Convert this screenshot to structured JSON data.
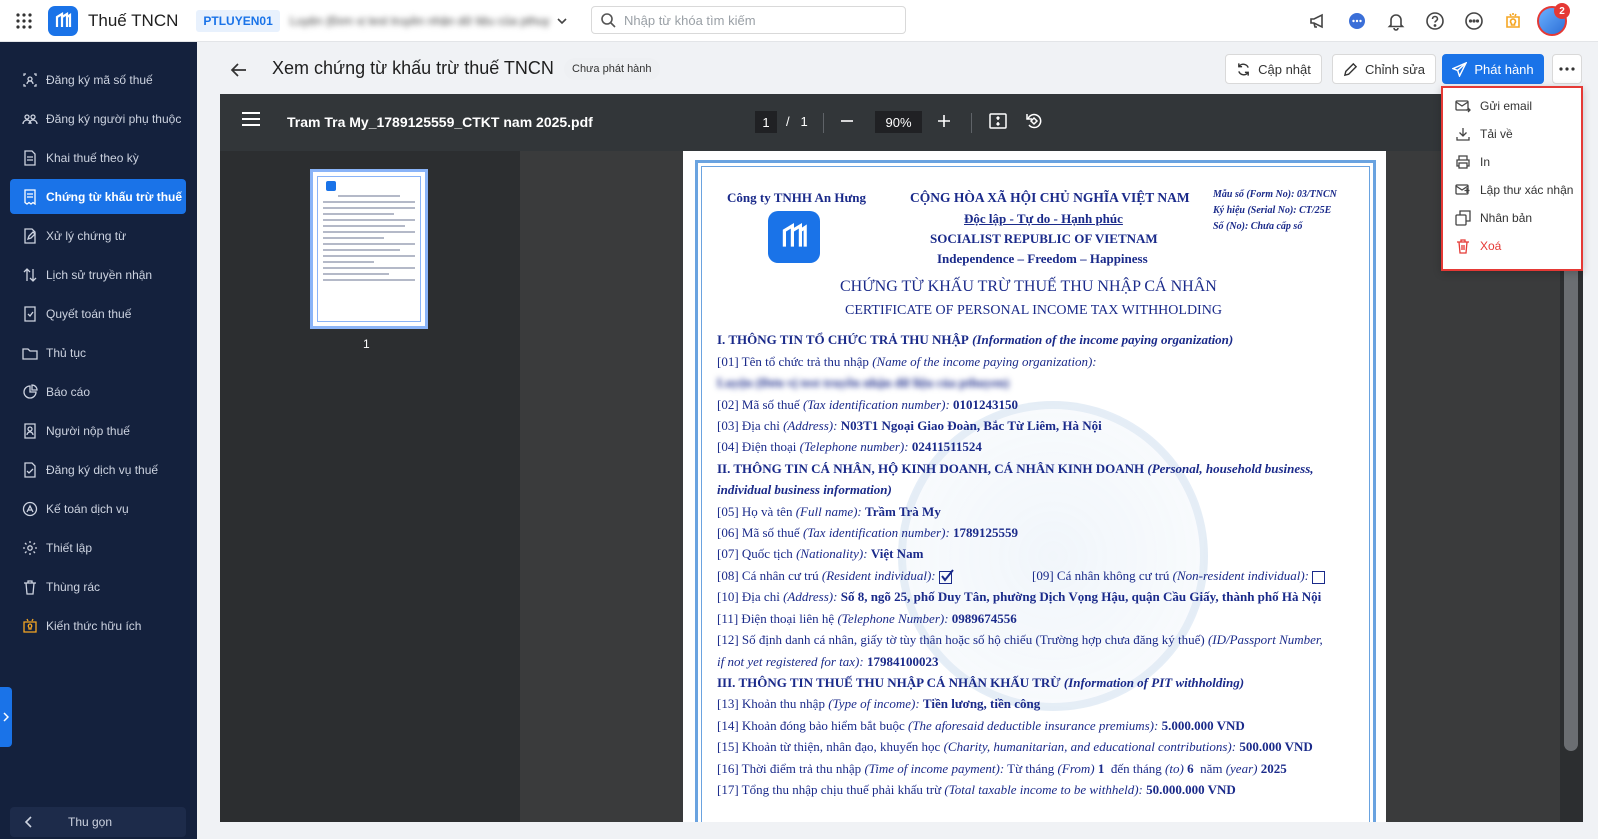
{
  "app": {
    "title": "Thuế TNCN",
    "org_code": "PTLUYEN01",
    "org_name": "Luyện (Đơn vị test truyền nhận dữ liệu của pthuyen)"
  },
  "search": {
    "placeholder": "Nhập từ khóa tìm kiếm"
  },
  "notifications": {
    "badge": "2"
  },
  "sidebar": {
    "items": [
      {
        "label": "Đăng ký mã số thuế",
        "icon": "id-card-icon"
      },
      {
        "label": "Đăng ký người phụ thuộc",
        "icon": "users-icon"
      },
      {
        "label": "Khai thuế theo kỳ",
        "icon": "document-icon"
      },
      {
        "label": "Chứng từ khấu trừ thuế",
        "icon": "receipt-icon"
      },
      {
        "label": "Xử lý chứng từ",
        "icon": "edit-document-icon"
      },
      {
        "label": "Lịch sử truyền nhận",
        "icon": "transfer-icon"
      },
      {
        "label": "Quyết toán thuế",
        "icon": "settlement-icon"
      },
      {
        "label": "Thủ tục",
        "icon": "folder-icon"
      },
      {
        "label": "Báo cáo",
        "icon": "report-icon"
      },
      {
        "label": "Người nộp thuế",
        "icon": "taxpayer-icon"
      },
      {
        "label": "Đăng ký dịch vụ thuế",
        "icon": "service-icon"
      },
      {
        "label": "Kế toán dịch vụ",
        "icon": "accounting-icon"
      },
      {
        "label": "Thiết lập",
        "icon": "settings-icon"
      },
      {
        "label": "Thùng rác",
        "icon": "trash-icon"
      },
      {
        "label": "Kiến thức hữu ích",
        "icon": "knowledge-icon"
      }
    ],
    "active_index": 3,
    "collapse_label": "Thu gọn"
  },
  "header": {
    "title": "Xem chứng từ khấu trừ thuế TNCN",
    "status": "Chưa phát hành",
    "update_label": "Cập nhật",
    "edit_label": "Chỉnh sửa",
    "publish_label": "Phát hành"
  },
  "viewer": {
    "file_name": "Tram Tra My_1789125559_CTKT nam 2025.pdf",
    "current_page": "1",
    "page_sep": "/",
    "total_pages": "1",
    "zoom": "90%",
    "thumb_label": "1"
  },
  "dropdown": {
    "items": [
      {
        "label": "Gửi email",
        "icon": "email-send-icon"
      },
      {
        "label": "Tải về",
        "icon": "download-icon"
      },
      {
        "label": "In",
        "icon": "printer-icon"
      },
      {
        "label": "Lập thư xác nhận",
        "icon": "confirm-letter-icon"
      },
      {
        "label": "Nhân bản",
        "icon": "duplicate-icon"
      },
      {
        "label": "Xoá",
        "icon": "delete-icon"
      }
    ]
  },
  "document": {
    "company": "Công ty TNHH An Hưng",
    "nation": "CỘNG HÒA XÃ HỘI CHỦ NGHĨA VIỆT NAM",
    "motto": "Độc lập - Tự do - Hạnh phúc",
    "nation_en": "SOCIALIST REPUBLIC OF VIETNAM",
    "motto_en": "Independence – Freedom – Happiness",
    "form_no": "Mẫu số (Form No): 03/TNCN",
    "serial_no": "Ký hiệu (Serial No): CT/25E",
    "doc_no": "Số (No): Chưa cấp số",
    "title": "CHỨNG TỪ KHẤU TRỪ THUẾ THU NHẬP CÁ NHÂN",
    "title_en": "CERTIFICATE OF PERSONAL INCOME TAX WITHHOLDING",
    "s1_head": "I.   THÔNG TIN TỔ CHỨC TRẢ THU NHẬP",
    "s1_head_en": "(Information of the income paying organization)",
    "f01": "[01]   Tên tổ chức trả thu nhập",
    "f01_en": "(Name of the income paying organization):",
    "f01_value": "Luyện (Đơn vị test truyền nhận dữ liệu của pthuyen)",
    "f02": "[02]   Mã số thuế",
    "f02_en": "(Tax identification number):",
    "f02_value": "0101243150",
    "f03": "[03]   Địa chỉ",
    "f03_en": "(Address):",
    "f03_value": "N03T1 Ngoại Giao Đoàn, Bắc Từ Liêm, Hà Nội",
    "f04": "[04]   Điện thoại",
    "f04_en": "(Telephone number):",
    "f04_value": "02411511524",
    "s2_head": "II.   THÔNG TIN CÁ NHÂN, HỘ KINH DOANH, CÁ NHÂN KINH DOANH",
    "s2_head_en": "(Personal, household business,",
    "s2_head_en2": "individual business information)",
    "f05": "[05]   Họ và tên",
    "f05_en": "(Full name):",
    "f05_value": "Trầm Trà My",
    "f06": "[06]   Mã số thuế",
    "f06_en": "(Tax identification number):",
    "f06_value": "1789125559",
    "f07": "[07]   Quốc tịch",
    "f07_en": "(Nationality):",
    "f07_value": "Việt Nam",
    "f08": "[08]   Cá nhân cư trú",
    "f08_en": "(Resident individual):",
    "f09": "[09]   Cá nhân không cư trú",
    "f09_en": "(Non-resident individual):",
    "f10": "[10]   Địa chỉ",
    "f10_en": "(Address):",
    "f10_value": "Số 8, ngõ 25, phố Duy Tân, phường Dịch Vọng Hậu, quận Cầu Giấy, thành phố Hà Nội",
    "f11": "[11]   Điện thoại liên hệ",
    "f11_en": "(Telephone Number):",
    "f11_value": "0989674556",
    "f12": "[12]   Số định danh cá nhân, giấy tờ tùy thân hoặc số hộ chiếu (Trường hợp chưa đăng ký thuế)",
    "f12_en": "(ID/Passport Number,",
    "f12_en2": "if not yet registered for tax):",
    "f12_value": "17984100023",
    "s3_head": "III.     THÔNG TIN THUẾ THU NHẬP CÁ NHÂN KHẤU TRỪ",
    "s3_head_en": "(Information of PIT withholding)",
    "f13": "[13]   Khoản thu nhập",
    "f13_en": "(Type of income):",
    "f13_value": "Tiền lương, tiền công",
    "f14": "[14]   Khoản đóng bảo hiểm bắt buộc",
    "f14_en": "(The aforesaid deductible insurance premiums):",
    "f14_value": "5.000.000 VND",
    "f15": "[15]   Khoản từ thiện, nhân đạo, khuyến học",
    "f15_en": "(Charity, humanitarian, and educational contributions):",
    "f15_value": "500.000 VND",
    "f16": "[16]   Thời điểm trả thu nhập",
    "f16_en": "(Time of income payment):",
    "f16_from": "Từ tháng",
    "f16_from_en": "(From)",
    "f16_from_value": "1",
    "f16_to": "đến tháng",
    "f16_to_en": "(to)",
    "f16_to_value": "6",
    "f16_year": "năm",
    "f16_year_en": "(year)",
    "f16_year_value": "2025",
    "f17": "[17]   Tổng thu nhập chịu thuế phải khấu trừ",
    "f17_en": "(Total taxable income to be withheld):",
    "f17_value": "50.000.000 VND"
  }
}
